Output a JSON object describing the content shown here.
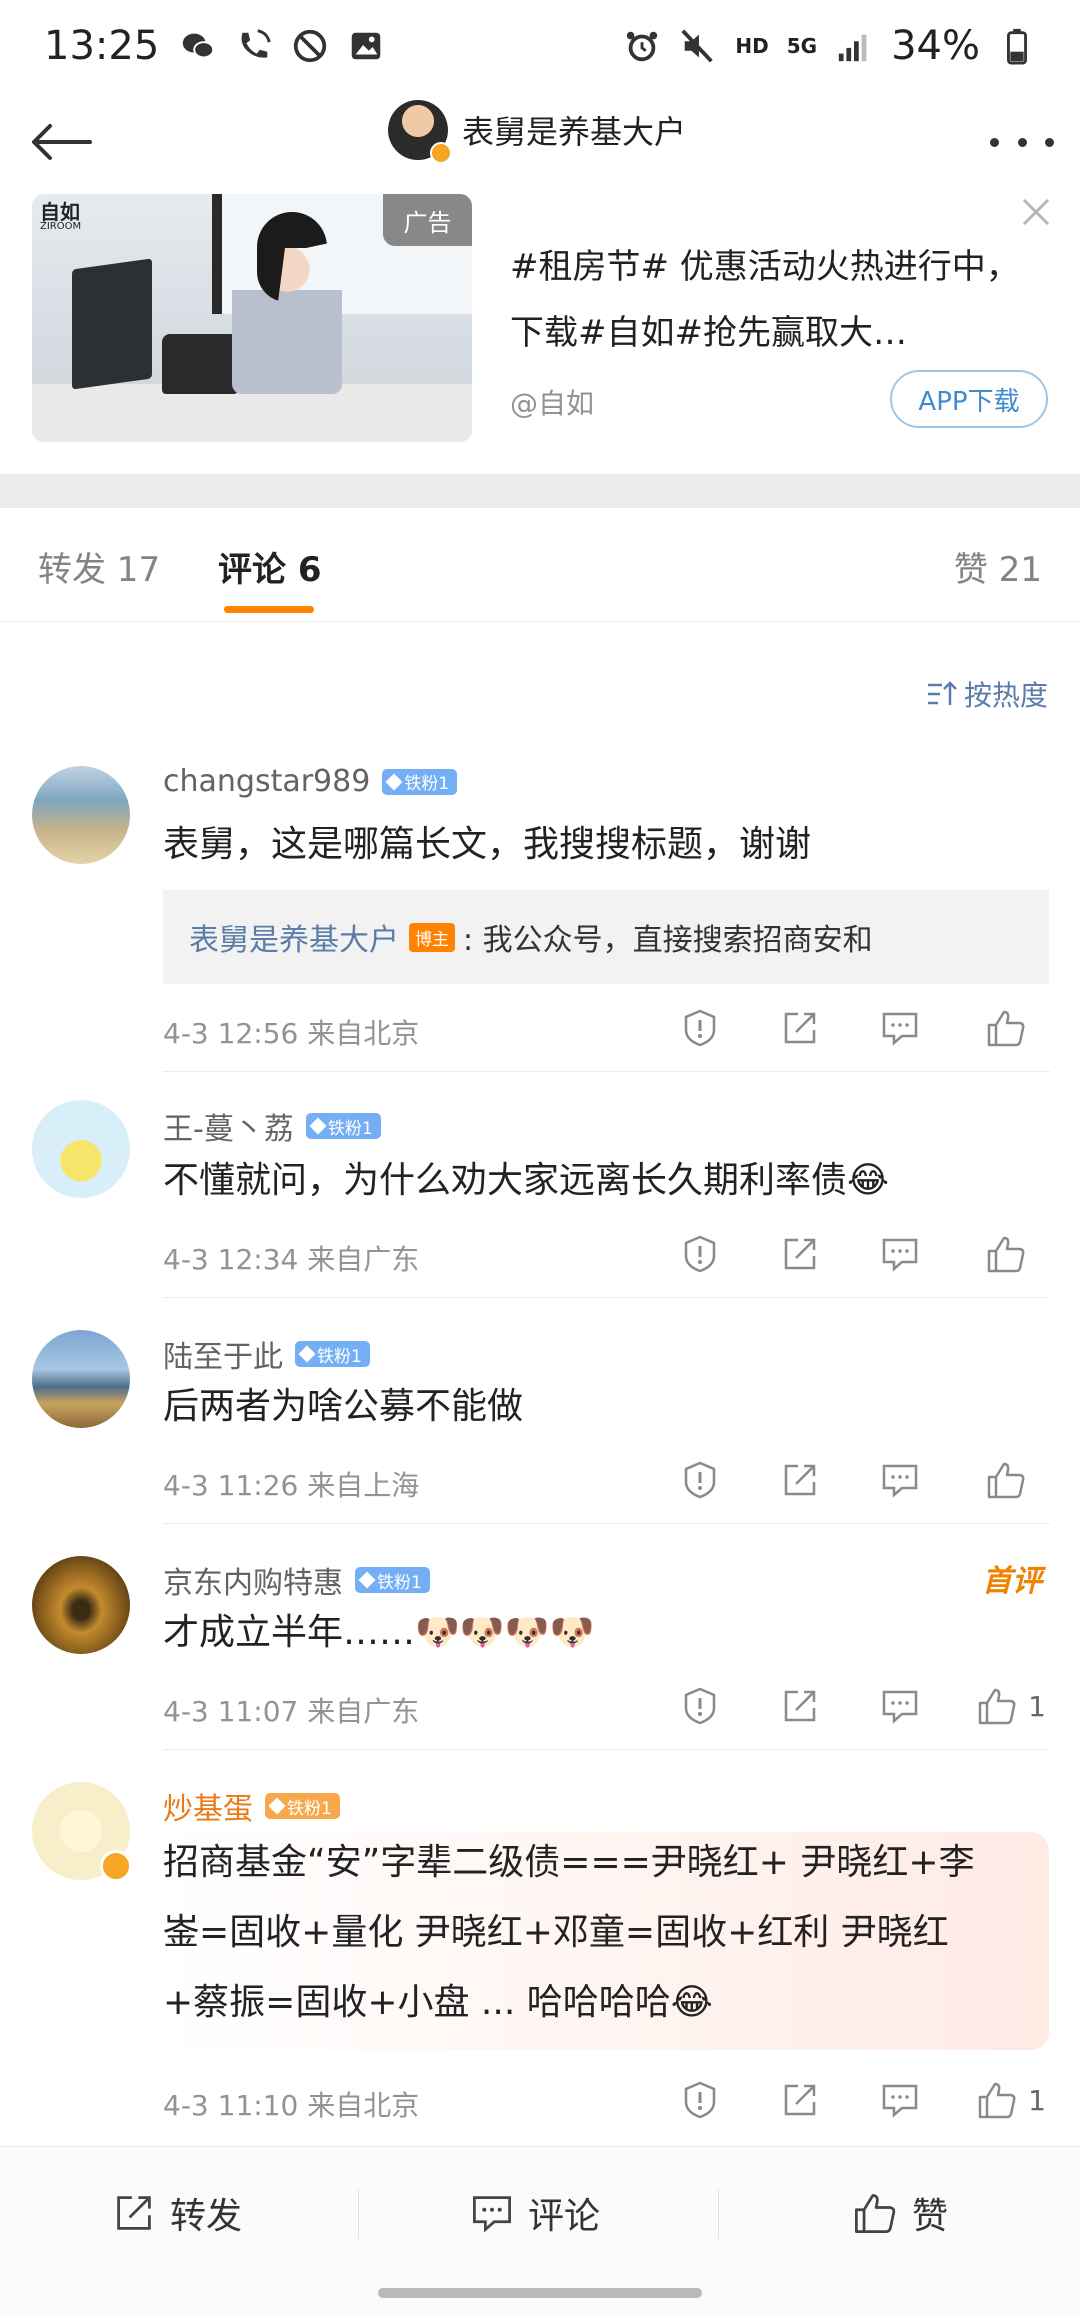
{
  "status_bar": {
    "time": "13:25",
    "network_label": "HD",
    "signal_label": "5G",
    "battery": "34%"
  },
  "nav": {
    "title": "表舅是养基大户"
  },
  "ad": {
    "tag": "广告",
    "logo": "自如",
    "logo_sub": "ZIROOM",
    "text": "#租房节# 优惠活动火热进行中，下载#自如#抢先赢取大…",
    "source": "@自如",
    "button": "APP下载"
  },
  "tabs": {
    "repost": "转发 17",
    "comment": "评论 6",
    "like": "赞 21"
  },
  "sort": {
    "label": "按热度"
  },
  "comments": [
    {
      "name": "changstar989",
      "badge": "铁粉1",
      "text": "表舅，这是哪篇长文，我搜搜标题，谢谢",
      "reply": {
        "name": "表舅是养基大户",
        "tag": "博主",
        "text": ": 我公众号，直接搜索招商安和"
      },
      "meta": "4-3 12:56  来自北京",
      "likes": ""
    },
    {
      "name": "王-蔓丶荔",
      "badge": "铁粉1",
      "text": "不懂就问，为什么劝大家远离长久期利率债😂",
      "meta": "4-3 12:34  来自广东",
      "likes": ""
    },
    {
      "name": "陆至于此",
      "badge": "铁粉1",
      "text": "后两者为啥公募不能做",
      "meta": "4-3 11:26  来自上海",
      "likes": ""
    },
    {
      "name": "京东内购特惠",
      "badge": "铁粉1",
      "first_tag": "首评",
      "text": "才成立半年……🐶🐶🐶🐶",
      "meta": "4-3 11:07  来自广东",
      "likes": "1"
    },
    {
      "name": "炒基蛋",
      "badge": "铁粉1",
      "text_lines": [
        "招商基金“安”字辈二级债===尹晓红+ 尹晓红+李",
        "崟=固收+量化 尹晓红+邓童=固收+红利 尹晓红",
        "+蔡振=固收+小盘 ... 哈哈哈哈😂"
      ],
      "meta": "4-3 11:10  来自北京",
      "likes": "1"
    }
  ],
  "bottom_bar": {
    "repost": "转发",
    "comment": "评论",
    "like": "赞"
  },
  "colors": {
    "accent": "#ff8200",
    "link": "#5a7da8",
    "badge": "#74aef4",
    "meta": "#939393"
  }
}
